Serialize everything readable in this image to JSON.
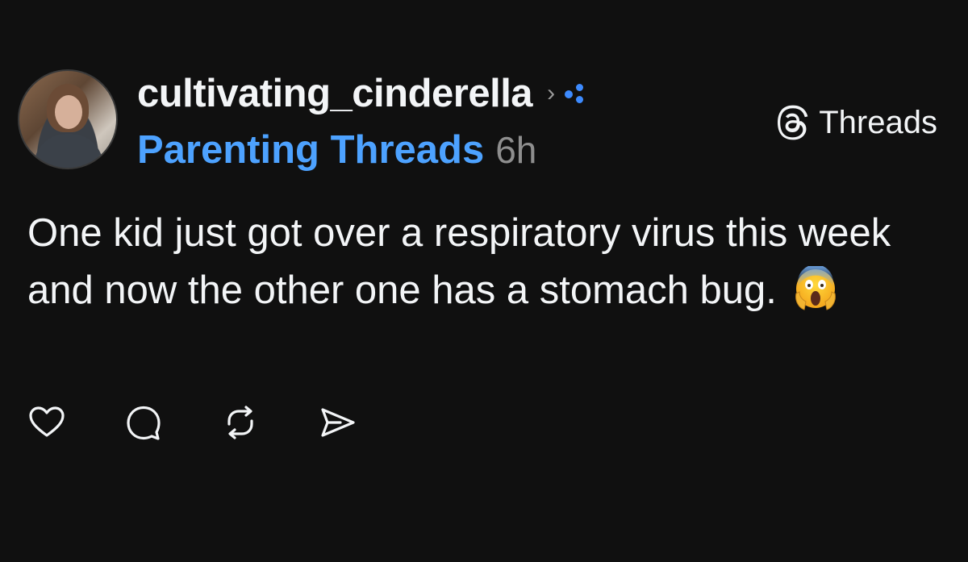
{
  "post": {
    "author": {
      "username": "cultivating_cinderella",
      "avatar_icon": "profile-photo"
    },
    "community": "Parenting Threads",
    "time": "6h",
    "text": "One kid just got over a respiratory virus this week and now the other one has a stomach bug.",
    "emoji": "😱",
    "actions": [
      {
        "name": "like",
        "icon": "heart-icon"
      },
      {
        "name": "reply",
        "icon": "comment-icon"
      },
      {
        "name": "repost",
        "icon": "repost-icon"
      },
      {
        "name": "share",
        "icon": "send-icon"
      }
    ]
  },
  "brand": {
    "label": "Threads",
    "icon": "threads-logo-icon"
  },
  "colors": {
    "background": "#101010",
    "text": "#f3f5f7",
    "accent": "#4da2ff",
    "muted": "#8e8e8e"
  }
}
